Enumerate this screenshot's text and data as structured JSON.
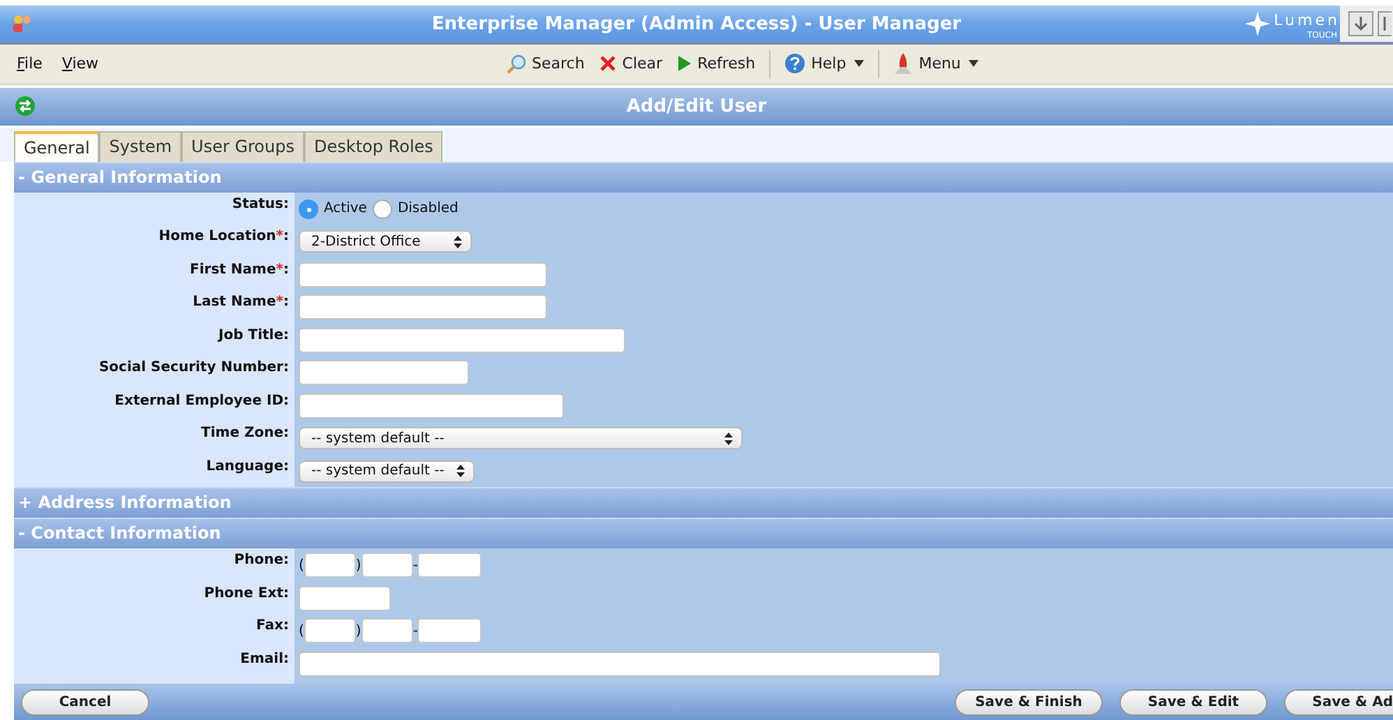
{
  "window": {
    "title": "Enterprise Manager (Admin Access) - User Manager",
    "logo": {
      "name": "Lumen",
      "sub": "TOUCH"
    }
  },
  "menu": [
    {
      "label": "File"
    },
    {
      "label": "View"
    }
  ],
  "toolbar": [
    {
      "label": "Search",
      "kind": "search",
      "dropdown": false
    },
    {
      "label": "Clear",
      "kind": "clear",
      "dropdown": false
    },
    {
      "label": "Refresh",
      "kind": "refresh",
      "dropdown": false
    },
    {
      "label": "Help",
      "kind": "help",
      "dropdown": true
    },
    {
      "label": "Menu",
      "kind": "menu",
      "dropdown": true
    }
  ],
  "page_title": "Add/Edit User",
  "tabs": [
    {
      "label": "General",
      "selected": true
    },
    {
      "label": "System",
      "selected": false
    },
    {
      "label": "User Groups",
      "selected": false
    },
    {
      "label": "Desktop Roles",
      "selected": false
    }
  ],
  "sections": [
    {
      "toggle": "-",
      "title": "General Information",
      "expanded": true,
      "fields": [
        {
          "label": "Status:",
          "kind": "radio",
          "options": [
            {
              "label": "Active",
              "selected": true
            },
            {
              "label": "Disabled",
              "selected": false
            }
          ]
        },
        {
          "label": "Home Location",
          "required_mark": "*",
          "colon": ":",
          "kind": "select",
          "value": "2-District Office"
        },
        {
          "label": "First Name",
          "required_mark": "*",
          "colon": ":",
          "kind": "text"
        },
        {
          "label": "Last Name",
          "required_mark": "*",
          "colon": ":",
          "kind": "text"
        },
        {
          "label": "Job Title:",
          "kind": "text"
        },
        {
          "label": "Social Security Number:",
          "kind": "text"
        },
        {
          "label": "External Employee ID:",
          "kind": "text"
        },
        {
          "label": "Time Zone:",
          "kind": "select",
          "value": "-- system default --"
        },
        {
          "label": "Language:",
          "kind": "select",
          "value": "-- system default --"
        }
      ]
    },
    {
      "toggle": "+",
      "title": "Address Information",
      "expanded": false
    },
    {
      "toggle": "-",
      "title": "Contact Information",
      "expanded": true,
      "fields": [
        {
          "label": "Phone:",
          "kind": "phone",
          "open": "(",
          "close": ")",
          "dash": "-"
        },
        {
          "label": "Phone Ext:",
          "kind": "text"
        },
        {
          "label": "Fax:",
          "kind": "phone",
          "open": "(",
          "close": ")",
          "dash": "-"
        },
        {
          "label": "Email:",
          "kind": "text"
        }
      ]
    }
  ],
  "footer": {
    "left": [
      "Cancel"
    ],
    "right": [
      "Save & Finish",
      "Save & Edit",
      "Save & Ad"
    ]
  }
}
